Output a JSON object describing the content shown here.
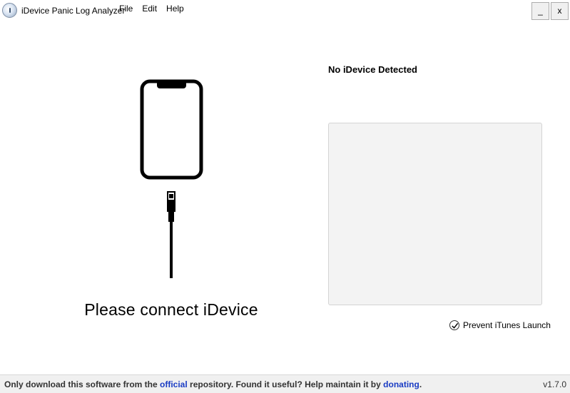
{
  "window": {
    "title": "iDevice Panic Log Analyzer",
    "minimize_label": "_",
    "close_label": "x"
  },
  "menu": {
    "items": [
      "File",
      "Edit",
      "Help"
    ]
  },
  "main": {
    "connect_message": "Please connect iDevice",
    "device_status": "No iDevice Detected",
    "prevent_itunes_label": "Prevent iTunes Launch",
    "prevent_itunes_checked": true
  },
  "statusbar": {
    "text_1": "Only download this software from the ",
    "link_official": "official",
    "text_2": " repository. Found it useful? Help maintain it by ",
    "link_donating": "donating",
    "text_3": ".",
    "version": "v1.7.0"
  },
  "colors": {
    "link": "#1a3cc4",
    "panel_bg": "#f3f3f3",
    "statusbar_bg": "#f0f0f0"
  }
}
